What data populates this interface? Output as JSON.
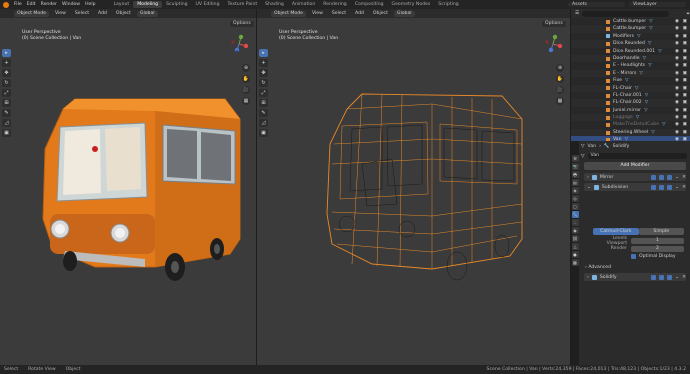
{
  "menu": [
    "File",
    "Edit",
    "Render",
    "Window",
    "Help"
  ],
  "workspaces": [
    "Layout",
    "Modeling",
    "Sculpting",
    "UV Editing",
    "Texture Paint",
    "Shading",
    "Animation",
    "Rendering",
    "Compositing",
    "Geometry Nodes",
    "Scripting"
  ],
  "active_workspace": "Modeling",
  "scene": {
    "assets": "Assets",
    "view_layer": "ViewLayer"
  },
  "vp_left": {
    "mode": "Object Mode",
    "view": "View",
    "select": "Select",
    "add": "Add",
    "object": "Object",
    "transform": "Global",
    "info1": "User Perspective",
    "info2": "(0) Scene Collection | Van",
    "options": "Options"
  },
  "vp_mid": {
    "mode": "Object Mode",
    "view": "View",
    "select": "Select",
    "add": "Add",
    "object": "Object",
    "transform": "Global",
    "info1": "User Perspective",
    "info2": "(0) Scene Collection | Van",
    "options": "Options"
  },
  "outliner": {
    "rows": [
      {
        "name": "Cattle.bumper",
        "type": "obj",
        "state": "normal"
      },
      {
        "name": "Cattle.bumper",
        "type": "obj",
        "state": "normal"
      },
      {
        "name": "Modifiers",
        "type": "mod",
        "state": "normal"
      },
      {
        "name": "Dice.Rounded",
        "type": "obj",
        "state": "normal"
      },
      {
        "name": "Dice.Rounded.001",
        "type": "obj",
        "state": "normal"
      },
      {
        "name": "Doorhandle",
        "type": "obj",
        "state": "normal"
      },
      {
        "name": "E - Headlights",
        "type": "obj",
        "state": "normal"
      },
      {
        "name": "E - Mirrors",
        "type": "obj",
        "state": "normal"
      },
      {
        "name": "Fixe",
        "type": "obj",
        "state": "normal"
      },
      {
        "name": "FL-Chair",
        "type": "obj",
        "state": "normal"
      },
      {
        "name": "FL-Chair.001",
        "type": "obj",
        "state": "normal"
      },
      {
        "name": "FL-Chair.002",
        "type": "obj",
        "state": "normal"
      },
      {
        "name": "Juniel.mirror",
        "type": "obj",
        "state": "normal"
      },
      {
        "name": "Luggage",
        "type": "obj",
        "state": "dim"
      },
      {
        "name": "MakeTheDetailCube",
        "type": "obj",
        "state": "dim"
      },
      {
        "name": "Steering.Wheel",
        "type": "obj",
        "state": "normal"
      },
      {
        "name": "Van",
        "type": "obj",
        "state": "selected"
      },
      {
        "name": "Window.wiper",
        "type": "obj",
        "state": "normal"
      },
      {
        "name": "Window.wiper.001",
        "type": "obj",
        "state": "normal"
      },
      {
        "name": "Wheel.Ax.Back",
        "type": "obj",
        "state": "normal"
      },
      {
        "name": "Wheel.Ax.Front",
        "type": "obj",
        "state": "normal"
      }
    ]
  },
  "properties": {
    "object_name": "Van",
    "breadcrumb_mod": "Solidify",
    "add_modifier": "Add Modifier",
    "modifiers": [
      {
        "name": "Mirror"
      },
      {
        "name": "Subdivision"
      }
    ],
    "subdiv_types": [
      "Catmull-Clark",
      "Simple"
    ],
    "levels_viewport_label": "Levels Viewport",
    "levels_viewport": "1",
    "render_label": "Render",
    "render": "2",
    "optimal_display": "Optimal Display",
    "advanced": "Advanced",
    "solidify": "Solidify"
  },
  "status": {
    "select": "Select",
    "rotate": "Rotate View",
    "object": "Object",
    "stats": "Scene Collection | Van | Verts:24,359 | Faces:24,013 | Tris:48,123 | Objects:1/23 | 4.3.2"
  }
}
